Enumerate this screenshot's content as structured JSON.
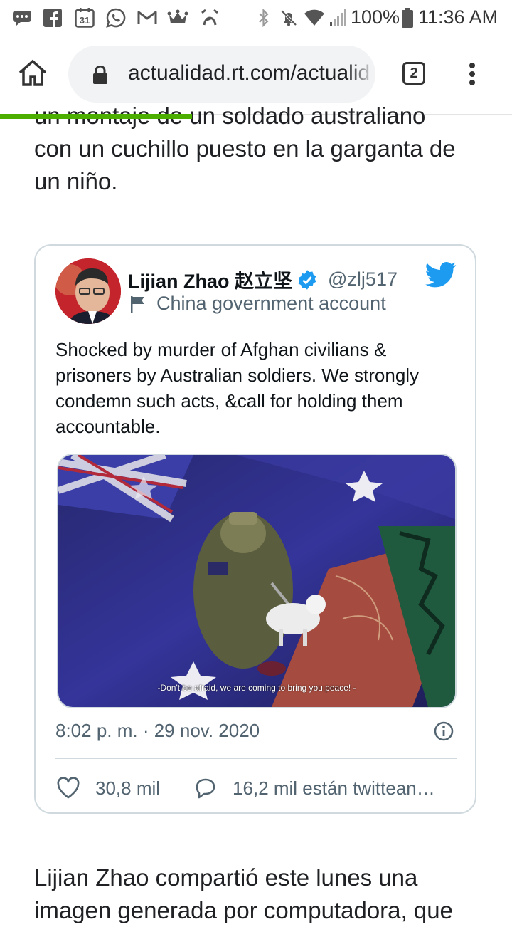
{
  "status_bar": {
    "battery": "100%",
    "time": "11:36 AM",
    "calendar_day": "31"
  },
  "browser": {
    "url": "actualidad.rt.com/actualidad",
    "tab_count": "2",
    "page_load_progress": 0.375
  },
  "article": {
    "text_top_partial": "un montaje de un soldado australiano",
    "text_top_line2": "con un cuchillo puesto en la garganta de",
    "text_top_line3": "un niño.",
    "text_bottom_line1": "Lijian Zhao compartió este lunes una",
    "text_bottom_partial": "imagen generada por computadora, que"
  },
  "tweet": {
    "author_name": "Lijian Zhao 赵立坚",
    "handle": "@zlj517",
    "account_label": "China government account",
    "text": "Shocked by murder of Afghan civilians & prisoners by Australian soldiers. We strongly condemn such acts, &call for holding them accountable.",
    "image_caption": "-Don't be afraid,  we are coming to bring you peace!  -",
    "timestamp": "8:02 p. m. · 29 nov. 2020",
    "likes": "30,8 mil",
    "retweets": "16,2 mil están twittean…"
  },
  "colors": {
    "twitter_blue": "#1d9bf0",
    "progress_green": "#4caf00",
    "border": "#cfd9de"
  },
  "icons": [
    "message-icon",
    "facebook-icon",
    "calendar-icon",
    "whatsapp-icon",
    "gmail-icon",
    "crown-icon",
    "alarm-off-icon",
    "bluetooth-icon",
    "mute-icon",
    "wifi-icon",
    "signal-icon",
    "battery-icon",
    "home-icon",
    "lock-icon",
    "tabs-icon",
    "more-vert-icon",
    "verified-icon",
    "twitter-icon",
    "flag-icon",
    "info-icon",
    "heart-icon",
    "reply-icon"
  ]
}
